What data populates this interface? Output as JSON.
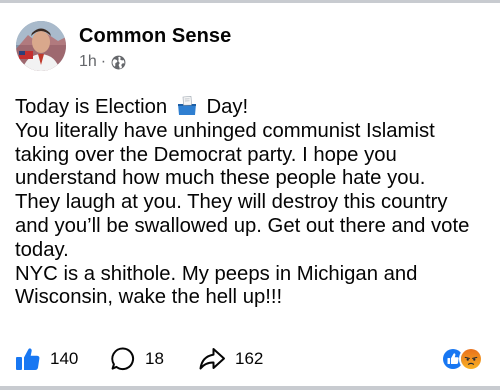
{
  "post": {
    "author": "Common Sense",
    "time": "1h",
    "separator": "·",
    "privacy_icon": "globe-icon",
    "avatar_icon": "profile-photo",
    "body": {
      "line1_before": "Today is Election",
      "line1_emoji": "ballot-box-icon",
      "line1_after": "Day!",
      "lines": [
        "You literally have unhinged communist Islamist",
        "taking over the Democrat party. I hope you",
        "understand how much these people hate you.",
        "They laugh at you. They will destroy this country",
        "and you’ll be swallowed up. Get out there and vote",
        "today.",
        "NYC is a shithole. My peeps in Michigan and",
        "Wisconsin, wake the hell up!!!"
      ]
    }
  },
  "actions": {
    "like_count": "140",
    "comment_count": "18",
    "share_count": "162",
    "like_icon": "thumbs-up-icon",
    "comment_icon": "comment-icon",
    "share_icon": "share-icon"
  },
  "reactions": {
    "icons": [
      "like-reaction-icon",
      "angry-reaction-icon"
    ]
  },
  "colors": {
    "like_blue": "#1877f2",
    "meta_gray": "#65676b",
    "angry_top": "#e9711c",
    "angry_bottom": "#f7b125",
    "border_gray": "#c8cbd0"
  }
}
